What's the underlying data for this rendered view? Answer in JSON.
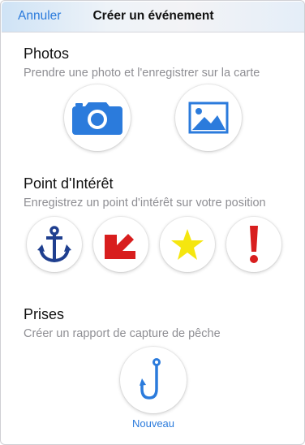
{
  "nav": {
    "cancel_label": "Annuler",
    "title": "Créer un événement"
  },
  "photos": {
    "title": "Photos",
    "subtitle": "Prendre une photo et l'enregistrer sur la carte",
    "buttons": [
      {
        "icon": "camera-icon",
        "color": "#2b7bdc"
      },
      {
        "icon": "image-gallery-icon",
        "color": "#2b7bdc"
      }
    ]
  },
  "poi": {
    "title": "Point d'Intérêt",
    "subtitle": "Enregistrez un point d'intérêt sur votre position",
    "buttons": [
      {
        "icon": "anchor-icon",
        "color": "#1f3f8f"
      },
      {
        "icon": "arrow-down-left-icon",
        "color": "#d81e1e"
      },
      {
        "icon": "star-icon",
        "color": "#f5e60f"
      },
      {
        "icon": "exclamation-icon",
        "color": "#d81e1e"
      }
    ]
  },
  "catches": {
    "title": "Prises",
    "subtitle": "Créer un rapport de capture de pêche",
    "new_label": "Nouveau",
    "button": {
      "icon": "fish-hook-icon",
      "color": "#2b7bdc"
    }
  }
}
